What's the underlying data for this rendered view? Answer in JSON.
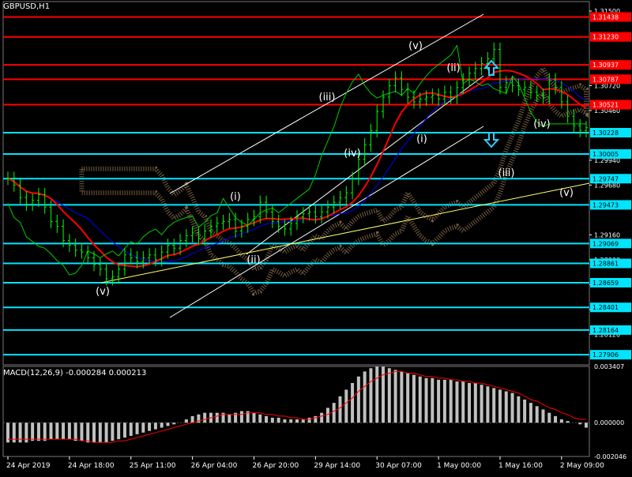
{
  "symbol_title": "GBPUSD,H1",
  "macd_title": "MACD(12,26,9) -0.000284 0.000213",
  "colors": {
    "background": "#000000",
    "axis": "#ffffff",
    "grid": "#555555",
    "price_bars": "#00ff00",
    "ma_red": "#ff0000",
    "ma_blue": "#0000ff",
    "ma_green": "#00cc00",
    "channel": "#ffffff",
    "trend_yellow": "#ffff66",
    "support_cyan": "#00e5ff",
    "resistance_red": "#ff0000",
    "cloud": "#c8a070",
    "macd_hist": "#c0c0c0",
    "macd_signal": "#ff0000",
    "arrow_cyan": "#33ccff"
  },
  "chart_data": [
    {
      "type": "candlestick",
      "title": "GBPUSD,H1",
      "ylim": [
        1.278,
        1.315
      ],
      "y_ticks": [
        "1.31500",
        "1.30720",
        "1.30460",
        "1.29940",
        "1.29680",
        "1.29160",
        "1.28900",
        "1.28640",
        "1.28380",
        "1.28120"
      ],
      "x_ticks": [
        "24 Apr 2019",
        "24 Apr 18:00",
        "25 Apr 11:00",
        "26 Apr 04:00",
        "26 Apr 20:00",
        "29 Apr 14:00",
        "30 Apr 07:00",
        "1 May 00:00",
        "1 May 16:00",
        "2 May 09:00"
      ],
      "x_tick_index": [
        0,
        10,
        20,
        30,
        40,
        50,
        60,
        70,
        80,
        90
      ],
      "close": [
        1.2975,
        1.2968,
        1.2955,
        1.2948,
        1.2952,
        1.2958,
        1.2945,
        1.293,
        1.2925,
        1.291,
        1.2905,
        1.29,
        1.2898,
        1.2892,
        1.2885,
        1.288,
        1.287,
        1.2872,
        1.288,
        1.2895,
        1.2892,
        1.2888,
        1.2892,
        1.2895,
        1.289,
        1.2898,
        1.2905,
        1.2902,
        1.291,
        1.2915,
        1.2918,
        1.2912,
        1.292,
        1.2925,
        1.2928,
        1.293,
        1.2932,
        1.292,
        1.2925,
        1.2932,
        1.2935,
        1.295,
        1.294,
        1.293,
        1.2925,
        1.2922,
        1.2928,
        1.2935,
        1.2938,
        1.294,
        1.2935,
        1.294,
        1.2945,
        1.295,
        1.2955,
        1.296,
        1.2975,
        1.2995,
        1.301,
        1.3025,
        1.3045,
        1.306,
        1.3072,
        1.308,
        1.3068,
        1.306,
        1.3055,
        1.3058,
        1.306,
        1.3062,
        1.3058,
        1.3065,
        1.306,
        1.307,
        1.3078,
        1.3085,
        1.309,
        1.3095,
        1.31,
        1.311,
        1.307,
        1.3075,
        1.3072,
        1.3068,
        1.307,
        1.3065,
        1.3062,
        1.306,
        1.3078,
        1.307,
        1.3055,
        1.304,
        1.303,
        1.3025,
        1.3028
      ],
      "horizontal_levels": {
        "resistance": [
          "1.31438",
          "1.31230",
          "1.30937",
          "1.30787",
          "1.30521"
        ],
        "support": [
          "1.30228",
          "1.30005",
          "1.29747",
          "1.29473",
          "1.29069",
          "1.28861",
          "1.28659",
          "1.28401",
          "1.28164",
          "1.27906"
        ]
      },
      "wave_labels": [
        "(v)",
        "(i)",
        "(ii)",
        "(iii)",
        "(iv)",
        "(v)",
        "(i)",
        "(ii)",
        "(iii)",
        "(iv)",
        "(v)"
      ]
    },
    {
      "type": "bar",
      "title": "MACD(12,26,9) -0.000284 0.000213",
      "ylim": [
        -0.002046,
        0.003407
      ],
      "y_ticks": [
        "0.003407",
        "0.000000",
        "-0.002046"
      ],
      "macd": [
        -0.0012,
        -0.0012,
        -0.0012,
        -0.0012,
        -0.0011,
        -0.0011,
        -0.0011,
        -0.001,
        -0.001,
        -0.001,
        -0.001,
        -0.0011,
        -0.0011,
        -0.0012,
        -0.0012,
        -0.0012,
        -0.0012,
        -0.0011,
        -0.001,
        -0.0009,
        -0.0008,
        -0.0007,
        -0.0006,
        -0.0005,
        -0.0004,
        -0.0003,
        -0.0002,
        -0.0001,
        0.0,
        0.0002,
        0.0004,
        0.0005,
        0.0006,
        0.0006,
        0.0006,
        0.0006,
        0.0005,
        0.0006,
        0.0007,
        0.0007,
        0.0006,
        0.0005,
        0.0004,
        0.0003,
        0.0003,
        0.0002,
        0.0002,
        0.0002,
        0.0002,
        0.0003,
        0.0004,
        0.0006,
        0.0009,
        0.0012,
        0.0016,
        0.002,
        0.0024,
        0.0028,
        0.0031,
        0.0033,
        0.0034,
        0.0034,
        0.0033,
        0.0032,
        0.0031,
        0.003,
        0.0029,
        0.0028,
        0.0027,
        0.0027,
        0.0026,
        0.0026,
        0.0026,
        0.0025,
        0.0025,
        0.0024,
        0.0024,
        0.0023,
        0.0022,
        0.0021,
        0.002,
        0.0019,
        0.0018,
        0.0016,
        0.0014,
        0.0012,
        0.001,
        0.0008,
        0.0006,
        0.0004,
        0.0002,
        0.0001,
        0.0,
        -0.0001,
        -0.0003
      ],
      "signal": [
        -0.001,
        -0.001,
        -0.001,
        -0.001,
        -0.001,
        -0.001,
        -0.001,
        -0.001,
        -0.001,
        -0.001,
        -0.001,
        -0.001,
        -0.0011,
        -0.0011,
        -0.0012,
        -0.0012,
        -0.0012,
        -0.0012,
        -0.0011,
        -0.0011,
        -0.001,
        -0.0009,
        -0.0008,
        -0.0007,
        -0.0006,
        -0.0005,
        -0.0004,
        -0.0003,
        -0.0002,
        -0.0001,
        0.0,
        0.0001,
        0.0002,
        0.0003,
        0.0004,
        0.0005,
        0.0005,
        0.0005,
        0.0005,
        0.0006,
        0.0006,
        0.0006,
        0.0005,
        0.0005,
        0.0004,
        0.0004,
        0.0003,
        0.0003,
        0.0002,
        0.0002,
        0.0003,
        0.0004,
        0.0005,
        0.0007,
        0.0009,
        0.0012,
        0.0015,
        0.0019,
        0.0022,
        0.0025,
        0.0027,
        0.0029,
        0.003,
        0.0031,
        0.0031,
        0.003,
        0.003,
        0.0029,
        0.0028,
        0.0028,
        0.0027,
        0.0027,
        0.0026,
        0.0026,
        0.0025,
        0.0025,
        0.0024,
        0.0024,
        0.0023,
        0.0022,
        0.0021,
        0.002,
        0.0019,
        0.0018,
        0.0016,
        0.0014,
        0.0013,
        0.0011,
        0.0009,
        0.0008,
        0.0006,
        0.0005,
        0.0003,
        0.0002,
        0.0002
      ]
    }
  ]
}
